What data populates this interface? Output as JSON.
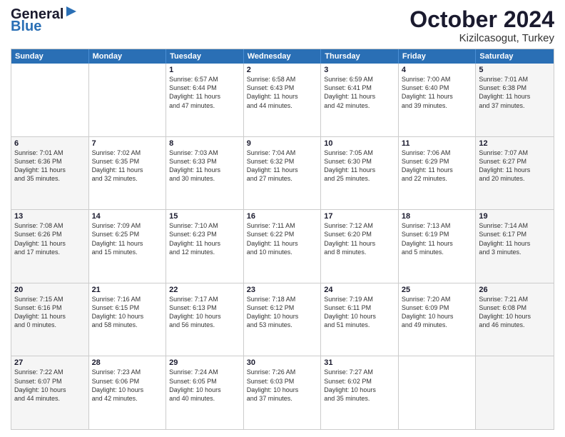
{
  "header": {
    "logo_line1": "General",
    "logo_line2": "Blue",
    "month": "October 2024",
    "location": "Kizilcasogut, Turkey"
  },
  "weekdays": [
    "Sunday",
    "Monday",
    "Tuesday",
    "Wednesday",
    "Thursday",
    "Friday",
    "Saturday"
  ],
  "rows": [
    [
      {
        "day": "",
        "lines": [],
        "shaded": false
      },
      {
        "day": "",
        "lines": [],
        "shaded": false
      },
      {
        "day": "1",
        "lines": [
          "Sunrise: 6:57 AM",
          "Sunset: 6:44 PM",
          "Daylight: 11 hours",
          "and 47 minutes."
        ],
        "shaded": false
      },
      {
        "day": "2",
        "lines": [
          "Sunrise: 6:58 AM",
          "Sunset: 6:43 PM",
          "Daylight: 11 hours",
          "and 44 minutes."
        ],
        "shaded": false
      },
      {
        "day": "3",
        "lines": [
          "Sunrise: 6:59 AM",
          "Sunset: 6:41 PM",
          "Daylight: 11 hours",
          "and 42 minutes."
        ],
        "shaded": false
      },
      {
        "day": "4",
        "lines": [
          "Sunrise: 7:00 AM",
          "Sunset: 6:40 PM",
          "Daylight: 11 hours",
          "and 39 minutes."
        ],
        "shaded": false
      },
      {
        "day": "5",
        "lines": [
          "Sunrise: 7:01 AM",
          "Sunset: 6:38 PM",
          "Daylight: 11 hours",
          "and 37 minutes."
        ],
        "shaded": true
      }
    ],
    [
      {
        "day": "6",
        "lines": [
          "Sunrise: 7:01 AM",
          "Sunset: 6:36 PM",
          "Daylight: 11 hours",
          "and 35 minutes."
        ],
        "shaded": true
      },
      {
        "day": "7",
        "lines": [
          "Sunrise: 7:02 AM",
          "Sunset: 6:35 PM",
          "Daylight: 11 hours",
          "and 32 minutes."
        ],
        "shaded": false
      },
      {
        "day": "8",
        "lines": [
          "Sunrise: 7:03 AM",
          "Sunset: 6:33 PM",
          "Daylight: 11 hours",
          "and 30 minutes."
        ],
        "shaded": false
      },
      {
        "day": "9",
        "lines": [
          "Sunrise: 7:04 AM",
          "Sunset: 6:32 PM",
          "Daylight: 11 hours",
          "and 27 minutes."
        ],
        "shaded": false
      },
      {
        "day": "10",
        "lines": [
          "Sunrise: 7:05 AM",
          "Sunset: 6:30 PM",
          "Daylight: 11 hours",
          "and 25 minutes."
        ],
        "shaded": false
      },
      {
        "day": "11",
        "lines": [
          "Sunrise: 7:06 AM",
          "Sunset: 6:29 PM",
          "Daylight: 11 hours",
          "and 22 minutes."
        ],
        "shaded": false
      },
      {
        "day": "12",
        "lines": [
          "Sunrise: 7:07 AM",
          "Sunset: 6:27 PM",
          "Daylight: 11 hours",
          "and 20 minutes."
        ],
        "shaded": true
      }
    ],
    [
      {
        "day": "13",
        "lines": [
          "Sunrise: 7:08 AM",
          "Sunset: 6:26 PM",
          "Daylight: 11 hours",
          "and 17 minutes."
        ],
        "shaded": true
      },
      {
        "day": "14",
        "lines": [
          "Sunrise: 7:09 AM",
          "Sunset: 6:25 PM",
          "Daylight: 11 hours",
          "and 15 minutes."
        ],
        "shaded": false
      },
      {
        "day": "15",
        "lines": [
          "Sunrise: 7:10 AM",
          "Sunset: 6:23 PM",
          "Daylight: 11 hours",
          "and 12 minutes."
        ],
        "shaded": false
      },
      {
        "day": "16",
        "lines": [
          "Sunrise: 7:11 AM",
          "Sunset: 6:22 PM",
          "Daylight: 11 hours",
          "and 10 minutes."
        ],
        "shaded": false
      },
      {
        "day": "17",
        "lines": [
          "Sunrise: 7:12 AM",
          "Sunset: 6:20 PM",
          "Daylight: 11 hours",
          "and 8 minutes."
        ],
        "shaded": false
      },
      {
        "day": "18",
        "lines": [
          "Sunrise: 7:13 AM",
          "Sunset: 6:19 PM",
          "Daylight: 11 hours",
          "and 5 minutes."
        ],
        "shaded": false
      },
      {
        "day": "19",
        "lines": [
          "Sunrise: 7:14 AM",
          "Sunset: 6:17 PM",
          "Daylight: 11 hours",
          "and 3 minutes."
        ],
        "shaded": true
      }
    ],
    [
      {
        "day": "20",
        "lines": [
          "Sunrise: 7:15 AM",
          "Sunset: 6:16 PM",
          "Daylight: 11 hours",
          "and 0 minutes."
        ],
        "shaded": true
      },
      {
        "day": "21",
        "lines": [
          "Sunrise: 7:16 AM",
          "Sunset: 6:15 PM",
          "Daylight: 10 hours",
          "and 58 minutes."
        ],
        "shaded": false
      },
      {
        "day": "22",
        "lines": [
          "Sunrise: 7:17 AM",
          "Sunset: 6:13 PM",
          "Daylight: 10 hours",
          "and 56 minutes."
        ],
        "shaded": false
      },
      {
        "day": "23",
        "lines": [
          "Sunrise: 7:18 AM",
          "Sunset: 6:12 PM",
          "Daylight: 10 hours",
          "and 53 minutes."
        ],
        "shaded": false
      },
      {
        "day": "24",
        "lines": [
          "Sunrise: 7:19 AM",
          "Sunset: 6:11 PM",
          "Daylight: 10 hours",
          "and 51 minutes."
        ],
        "shaded": false
      },
      {
        "day": "25",
        "lines": [
          "Sunrise: 7:20 AM",
          "Sunset: 6:09 PM",
          "Daylight: 10 hours",
          "and 49 minutes."
        ],
        "shaded": false
      },
      {
        "day": "26",
        "lines": [
          "Sunrise: 7:21 AM",
          "Sunset: 6:08 PM",
          "Daylight: 10 hours",
          "and 46 minutes."
        ],
        "shaded": true
      }
    ],
    [
      {
        "day": "27",
        "lines": [
          "Sunrise: 7:22 AM",
          "Sunset: 6:07 PM",
          "Daylight: 10 hours",
          "and 44 minutes."
        ],
        "shaded": true
      },
      {
        "day": "28",
        "lines": [
          "Sunrise: 7:23 AM",
          "Sunset: 6:06 PM",
          "Daylight: 10 hours",
          "and 42 minutes."
        ],
        "shaded": false
      },
      {
        "day": "29",
        "lines": [
          "Sunrise: 7:24 AM",
          "Sunset: 6:05 PM",
          "Daylight: 10 hours",
          "and 40 minutes."
        ],
        "shaded": false
      },
      {
        "day": "30",
        "lines": [
          "Sunrise: 7:26 AM",
          "Sunset: 6:03 PM",
          "Daylight: 10 hours",
          "and 37 minutes."
        ],
        "shaded": false
      },
      {
        "day": "31",
        "lines": [
          "Sunrise: 7:27 AM",
          "Sunset: 6:02 PM",
          "Daylight: 10 hours",
          "and 35 minutes."
        ],
        "shaded": false
      },
      {
        "day": "",
        "lines": [],
        "shaded": false
      },
      {
        "day": "",
        "lines": [],
        "shaded": true
      }
    ]
  ]
}
